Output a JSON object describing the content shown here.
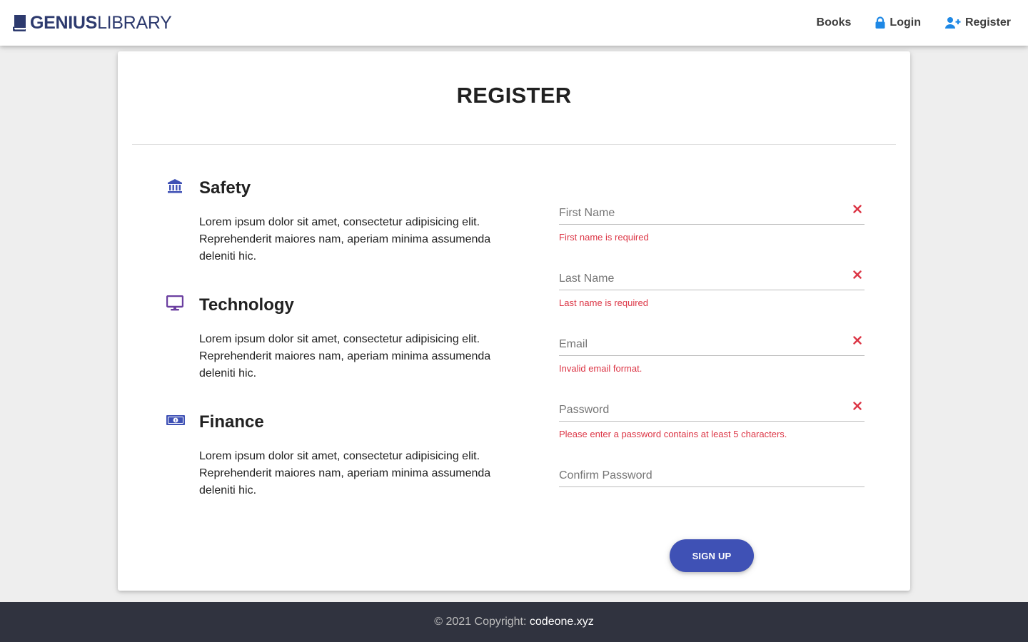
{
  "brand": {
    "part1": "GENIUS",
    "part2": "LIBRARY",
    "icon": "book-icon"
  },
  "nav": [
    {
      "label": "Books",
      "icon": ""
    },
    {
      "label": "Login",
      "icon": "lock-icon"
    },
    {
      "label": "Register",
      "icon": "user-plus-icon"
    }
  ],
  "page": {
    "title": "REGISTER"
  },
  "features": [
    {
      "icon": "bank-icon",
      "title": "Safety",
      "text": "Lorem ipsum dolor sit amet, consectetur adipisicing elit. Reprehenderit maiores nam, aperiam minima assumenda deleniti hic."
    },
    {
      "icon": "monitor-icon",
      "title": "Technology",
      "text": "Lorem ipsum dolor sit amet, consectetur adipisicing elit. Reprehenderit maiores nam, aperiam minima assumenda deleniti hic."
    },
    {
      "icon": "money-bill-icon",
      "title": "Finance",
      "text": "Lorem ipsum dolor sit amet, consectetur adipisicing elit. Reprehenderit maiores nam, aperiam minima assumenda deleniti hic."
    }
  ],
  "form": {
    "first_name": {
      "placeholder": "First Name",
      "value": "",
      "error": "First name is required"
    },
    "last_name": {
      "placeholder": "Last Name",
      "value": "",
      "error": "Last name is required"
    },
    "email": {
      "placeholder": "Email",
      "value": "",
      "error": "Invalid email format."
    },
    "password": {
      "placeholder": "Password",
      "value": "",
      "error": "Please enter a password contains at least 5 characters."
    },
    "confirm_password": {
      "placeholder": "Confirm Password",
      "value": ""
    },
    "submit_label": "SIGN UP"
  },
  "footer": {
    "text": "© 2021 Copyright: ",
    "link": "codeone.xyz"
  },
  "colors": {
    "accent": "#3f51b5",
    "brand": "#2d3a6e",
    "error": "#dc3545",
    "nav_icon": "#1e88e5",
    "footer_bg": "#30333f"
  }
}
